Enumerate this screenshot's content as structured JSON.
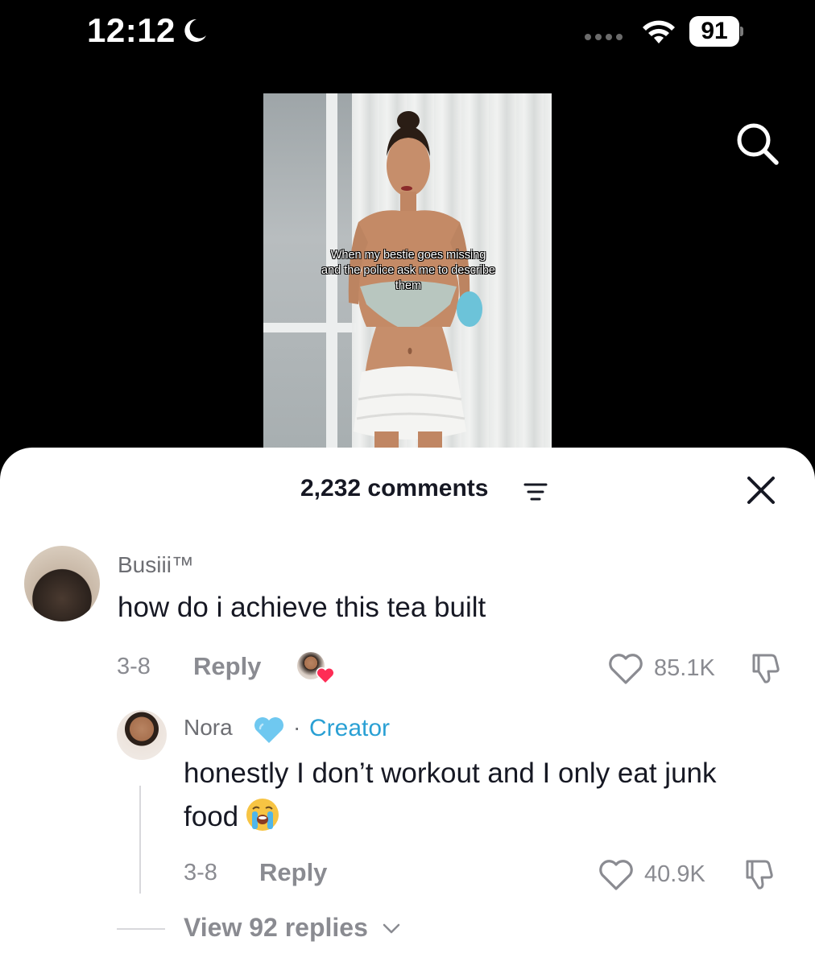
{
  "status_bar": {
    "time": "12:12",
    "battery": "91",
    "icons": [
      "moon-icon",
      "signal-dots",
      "wifi-icon",
      "battery-icon"
    ]
  },
  "video": {
    "caption": "When my bestie goes missing and the police ask me to describe them"
  },
  "toolbar": {
    "search_icon": "search-icon"
  },
  "comments_sheet": {
    "count_label": "2,232 comments",
    "sort_icon": "sort-icon",
    "close_icon": "close-icon",
    "comment": {
      "username": "Busiii™",
      "text": "how do i achieve this tea built",
      "date": "3-8",
      "reply_label": "Reply",
      "likes": "85.1K",
      "liked_by_creator": true
    },
    "reply": {
      "username": "Nora",
      "badge_icon": "blue-heart-icon",
      "separator": "·",
      "creator_label": "Creator",
      "text": "honestly I don’t workout and I only eat junk food",
      "emoji": "loudly-crying-face-icon",
      "date": "3-8",
      "reply_label": "Reply",
      "likes": "40.9K"
    },
    "view_replies_label": "View 92 replies"
  },
  "colors": {
    "background_top": "#000000",
    "sheet": "#ffffff",
    "text_primary": "#161823",
    "text_secondary": "#8a8b91",
    "creator_blue": "#2aa0d4",
    "heart_red": "#fe2c55"
  }
}
